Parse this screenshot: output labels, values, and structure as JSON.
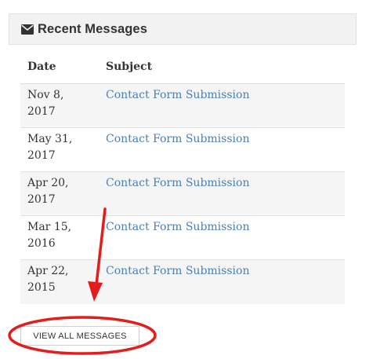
{
  "panel": {
    "title": "Recent Messages",
    "icon": "envelope-icon"
  },
  "table": {
    "headers": {
      "date": "Date",
      "subject": "Subject"
    },
    "rows": [
      {
        "date_line1": "Nov 8,",
        "date_line2": "2017",
        "subject": "Contact Form Submission"
      },
      {
        "date_line1": "May 31,",
        "date_line2": "2017",
        "subject": "Contact Form Submission"
      },
      {
        "date_line1": "Apr 20,",
        "date_line2": "2017",
        "subject": "Contact Form Submission"
      },
      {
        "date_line1": "Mar 15,",
        "date_line2": "2016",
        "subject": "Contact Form Submission"
      },
      {
        "date_line1": "Apr 22,",
        "date_line2": "2015",
        "subject": "Contact Form Submission"
      }
    ]
  },
  "actions": {
    "view_all_label": "VIEW ALL MESSAGES"
  },
  "annotation": {
    "color": "#e51c1c",
    "shapes": [
      "red-arrow",
      "red-ellipse"
    ]
  },
  "colors": {
    "link": "#4a7fb5",
    "header_bg": "#f2f2f2",
    "row_stripe": "#f5f5f5",
    "text": "#333333"
  }
}
